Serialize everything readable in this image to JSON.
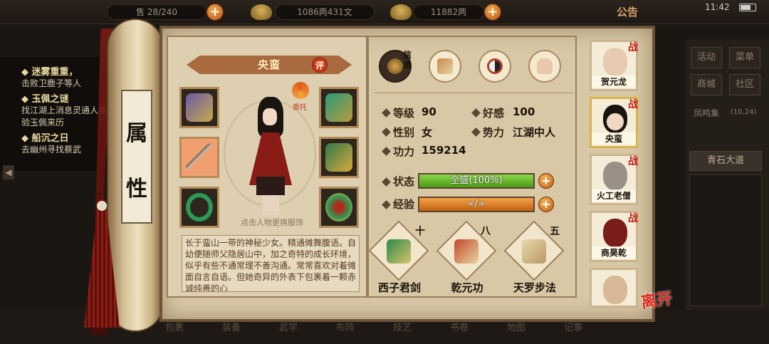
{
  "topbar": {
    "stamina_value": "28/240",
    "stamina_prefix": "售",
    "money_value": "1086两431文",
    "ingot_value": "11882两",
    "announcement": "公告",
    "time": "11:42"
  },
  "tasks": [
    {
      "title": "迷雾重重，",
      "desc": "击败卫鹿子等人"
    },
    {
      "title": "玉佩之谜",
      "desc": "找江湖上消息灵通人查验玉佩来历"
    },
    {
      "title": "船沉之日",
      "desc": "去幽州寻找蔡武"
    }
  ],
  "right_menu": {
    "items": [
      "活动",
      "菜单",
      "商城",
      "社区"
    ],
    "channel": "凤鸣集",
    "channel_count": "(10,24)",
    "location": "青石大道"
  },
  "scroll_label": [
    "属",
    "性"
  ],
  "character": {
    "name": "央蛮",
    "rate_label": "评",
    "entrust_label": "委托",
    "change_tip": "点击人物更换服饰",
    "bio": "长于蛮山一带的神秘少女。精通傩舞腹语。自幼便随师父隐居山中，加之奇特的成长环境，似乎有些不通常理不善沟通。常常喜欢对着傩面自言自语。但她奇异的外表下包裹着一颗赤诚纯善的心"
  },
  "tabs": {
    "info_label": "信息"
  },
  "stats": {
    "level_label": "等级",
    "level": "90",
    "favor_label": "好感",
    "favor": "100",
    "gender_label": "性别",
    "gender": "女",
    "faction_label": "势力",
    "faction": "江湖中人",
    "power_label": "功力",
    "power": "159214",
    "status_label": "状态",
    "status_text": "全盛(100%)",
    "status_pct": 1.0,
    "exp_label": "经验",
    "exp_text": "∞/∞",
    "exp_pct": 1.0
  },
  "skills": [
    {
      "level": "十",
      "name": "西子君剑"
    },
    {
      "level": "八",
      "name": "乾元功"
    },
    {
      "level": "五",
      "name": "天罗步法"
    }
  ],
  "companions": [
    {
      "name": "贺元龙"
    },
    {
      "name": "央蛮"
    },
    {
      "name": "火工老僧"
    },
    {
      "name": "商昊乾"
    },
    {
      "name": ""
    }
  ],
  "companion_badge": "战",
  "leave_label": "离开",
  "bottom_menu": [
    "包裹",
    "装备",
    "武学",
    "布阵",
    "技艺",
    "书卷",
    "地图",
    "记事"
  ],
  "colors": {
    "status_fill": "#5fae1e",
    "exp_fill": "#e07a18",
    "accent_red": "#c21f14"
  }
}
